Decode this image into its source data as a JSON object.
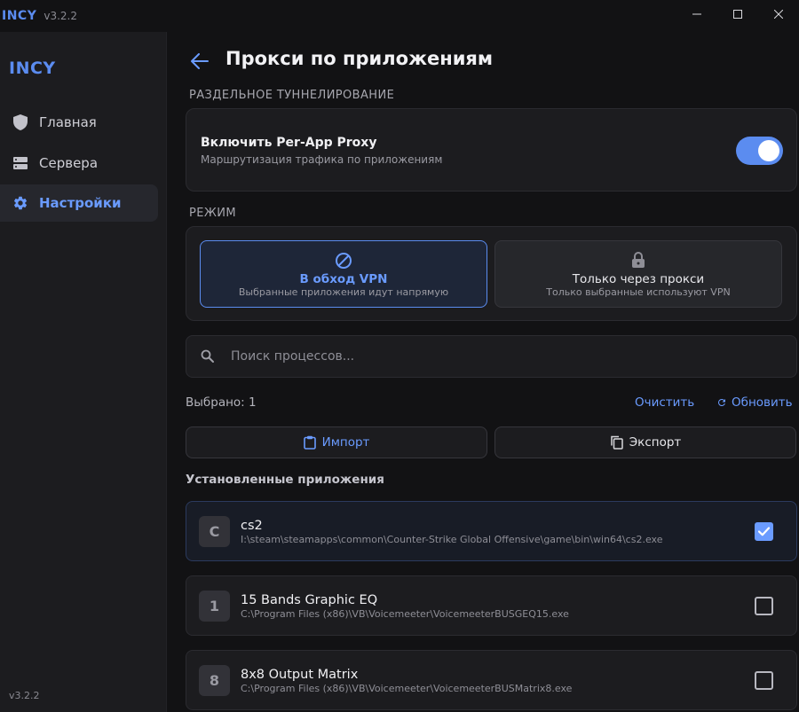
{
  "titlebar": {
    "app_name": "INCY",
    "version": "v3.2.2"
  },
  "sidebar": {
    "logo": "INCY",
    "items": [
      {
        "label": "Главная",
        "icon": "shield-icon",
        "active": false
      },
      {
        "label": "Сервера",
        "icon": "server-icon",
        "active": false
      },
      {
        "label": "Настройки",
        "icon": "gear-icon",
        "active": true
      }
    ],
    "version": "v3.2.2"
  },
  "page": {
    "title": "Прокси по приложениям"
  },
  "split_tunneling": {
    "section_label": "РАЗДЕЛЬНОЕ ТУННЕЛИРОВАНИЕ",
    "toggle_title": "Включить Per-App Proxy",
    "toggle_subtitle": "Маршрутизация трафика по приложениям",
    "enabled": true
  },
  "mode": {
    "section_label": "РЕЖИМ",
    "options": [
      {
        "title": "В обход VPN",
        "subtitle": "Выбранные приложения идут напрямую",
        "icon": "block-icon",
        "selected": true
      },
      {
        "title": "Только через прокси",
        "subtitle": "Только выбранные используют VPN",
        "icon": "lock-icon",
        "selected": false
      }
    ]
  },
  "search": {
    "placeholder": "Поиск процессов...",
    "value": ""
  },
  "selection": {
    "count_label": "Выбрано: 1",
    "clear_label": "Очистить",
    "refresh_label": "Обновить"
  },
  "actions": {
    "import_label": "Импорт",
    "export_label": "Экспорт"
  },
  "installed": {
    "heading": "Установленные приложения",
    "apps": [
      {
        "initial": "C",
        "name": "cs2",
        "path": "I:\\steam\\steamapps\\common\\Counter-Strike Global Offensive\\game\\bin\\win64\\cs2.exe",
        "checked": true
      },
      {
        "initial": "1",
        "name": "15 Bands Graphic EQ",
        "path": "C:\\Program Files (x86)\\VB\\Voicemeeter\\VoicemeeterBUSGEQ15.exe",
        "checked": false
      },
      {
        "initial": "8",
        "name": "8x8 Output Matrix",
        "path": "C:\\Program Files (x86)\\VB\\Voicemeeter\\VoicemeeterBUSMatrix8.exe",
        "checked": false
      }
    ]
  },
  "colors": {
    "accent": "#5b8cf0",
    "background": "#121214",
    "sidebar": "#1c1c1f",
    "card": "#1c1c1f"
  }
}
